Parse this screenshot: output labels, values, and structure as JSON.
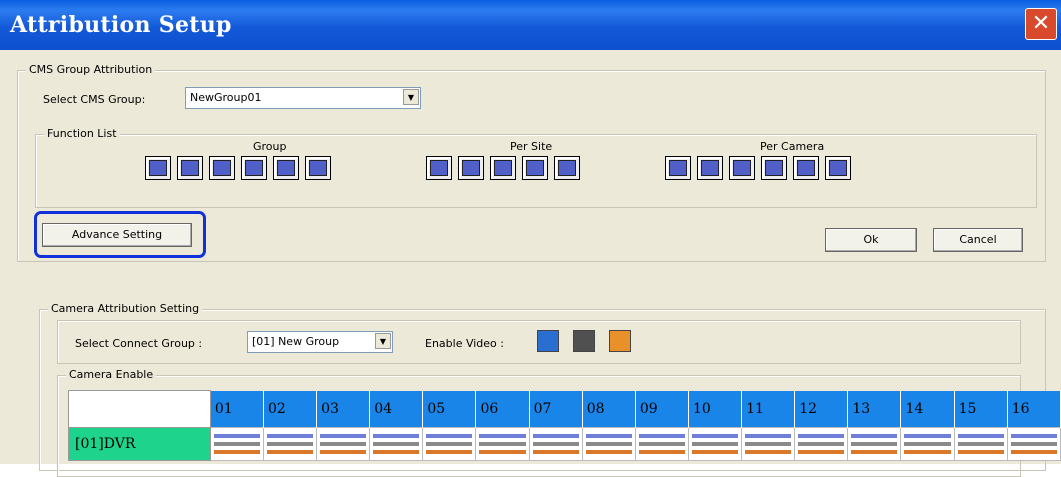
{
  "window": {
    "title": "Attribution Setup",
    "close_glyph": "✕"
  },
  "cms_group": {
    "legend": "CMS Group Attribution",
    "select_label": "Select CMS Group:",
    "select_value": "NewGroup01"
  },
  "function_list": {
    "legend": "Function List",
    "groups": [
      {
        "label": "Group",
        "icons": [
          "arrow-left-icon",
          "split-view-icon",
          "network-icon",
          "clock-icon",
          "help-icon",
          "lock-icon"
        ]
      },
      {
        "label": "Per Site",
        "icons": [
          "connect-icon",
          "film-icon",
          "gear-icon",
          "search-icon",
          "export-icon"
        ]
      },
      {
        "label": "Per Camera",
        "icons": [
          "fullscreen-icon",
          "edit-icon",
          "record-icon",
          "text-icon",
          "ptz-icon",
          "audio-icon"
        ]
      }
    ]
  },
  "buttons": {
    "advance": "Advance Setting",
    "ok": "Ok",
    "cancel": "Cancel"
  },
  "colors": {
    "highlight": "#1030d8",
    "header_blue": "#1a85e8",
    "dvr_green": "#1ed48c",
    "line_blue": "#6f7fd8",
    "line_orange": "#d9772a",
    "line_gray": "#8a8a8a"
  },
  "camera_setting": {
    "legend": "Camera Attribution Setting",
    "connect_label": "Select Connect Group :",
    "connect_value": "[01] New Group",
    "enable_video_label": "Enable Video :",
    "enable_video_icons": [
      "monitor-icon",
      "arrow-left-icon",
      "camera-icon"
    ]
  },
  "camera_enable": {
    "legend": "Camera Enable",
    "columns": [
      "01",
      "02",
      "03",
      "04",
      "05",
      "06",
      "07",
      "08",
      "09",
      "10",
      "11",
      "12",
      "13",
      "14",
      "15",
      "16"
    ],
    "rows": [
      {
        "label": "[01]DVR"
      }
    ]
  }
}
